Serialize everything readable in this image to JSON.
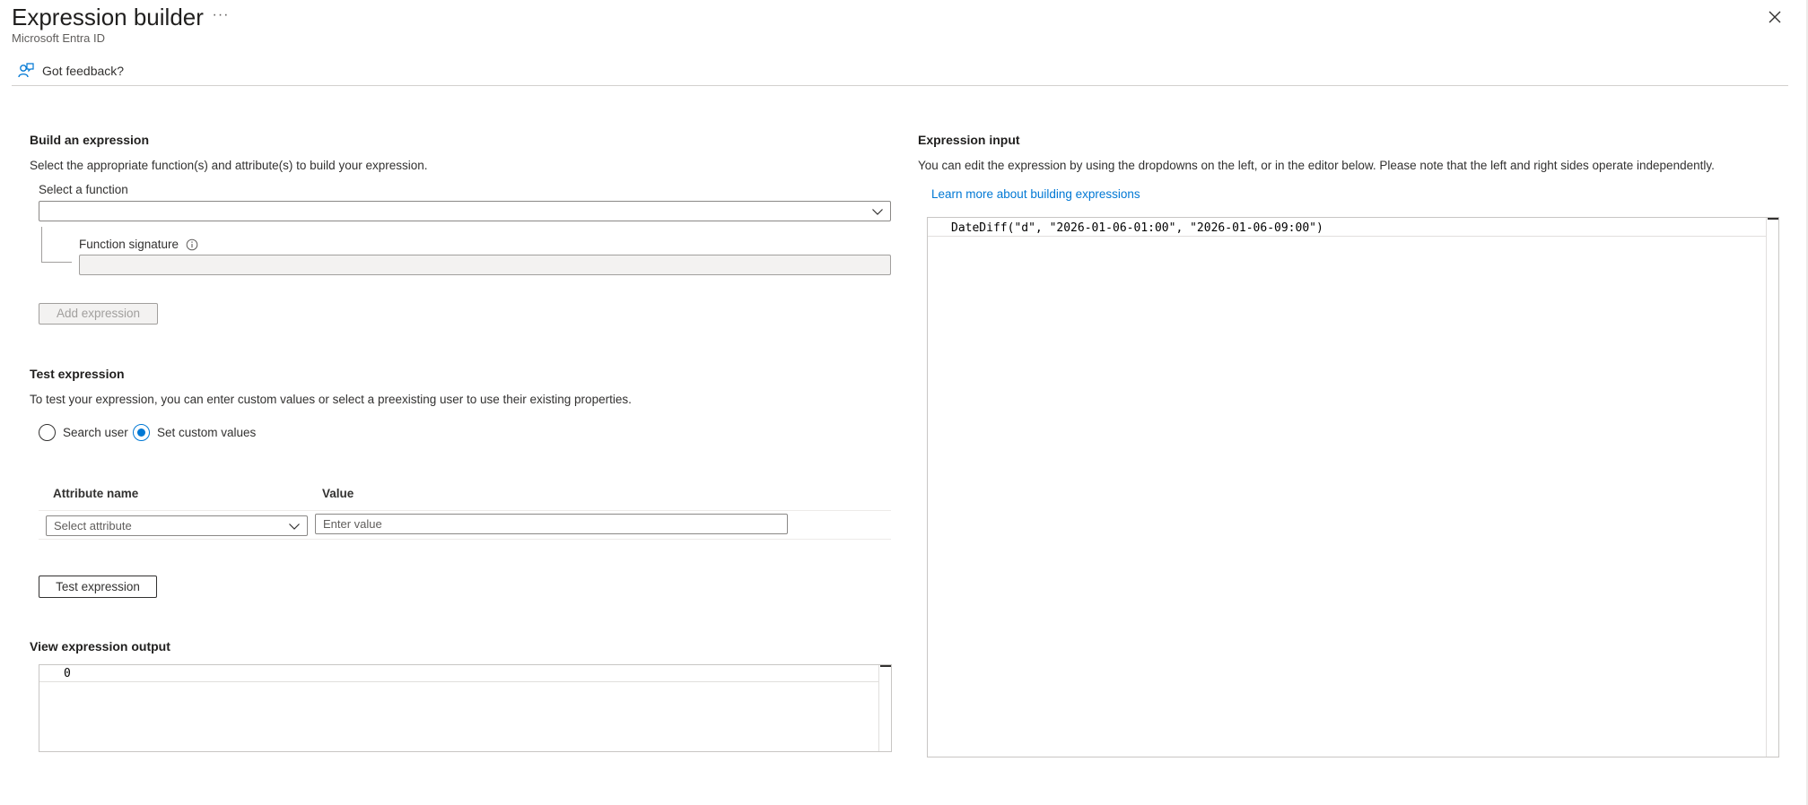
{
  "header": {
    "title": "Expression builder",
    "more_label": "···",
    "subtitle": "Microsoft Entra ID",
    "close_icon": "close-icon"
  },
  "toolbar": {
    "feedback_label": "Got feedback?",
    "feedback_icon": "feedback-icon"
  },
  "build": {
    "title": "Build an expression",
    "description": "Select the appropriate function(s) and attribute(s) to build your expression.",
    "function_label": "Select a function",
    "function_value": "",
    "signature_label": "Function signature",
    "signature_value": "",
    "add_button": "Add expression"
  },
  "test": {
    "title": "Test expression",
    "description": "To test your expression, you can enter custom values or select a preexisting user to use their existing properties.",
    "radio_options": [
      {
        "label": "Search user",
        "checked": false
      },
      {
        "label": "Set custom values",
        "checked": true
      }
    ],
    "columns": {
      "attribute": "Attribute name",
      "value": "Value"
    },
    "attribute_placeholder": "Select attribute",
    "value_placeholder": "Enter value",
    "test_button": "Test expression"
  },
  "output": {
    "title": "View expression output",
    "value": "0"
  },
  "input": {
    "title": "Expression input",
    "description": "You can edit the expression by using the dropdowns on the left, or in the editor below. Please note that the left and right sides operate independently.",
    "learn_link": "Learn more about building expressions",
    "code": "DateDiff(\"d\", \"2026-01-06-01:00\", \"2026-01-06-09:00\")"
  },
  "colors": {
    "accent": "#0078d4",
    "text": "#323130",
    "border": "#8a8886",
    "disabled_bg": "#f3f2f1"
  }
}
